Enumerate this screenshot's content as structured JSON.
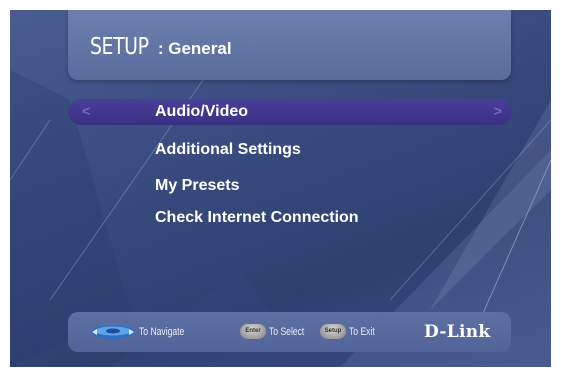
{
  "header": {
    "title_main": "SETUP",
    "title_sub": ": General"
  },
  "menu": {
    "selected_index": 0,
    "items": [
      {
        "label": "Audio/Video"
      },
      {
        "label": "Additional Settings"
      },
      {
        "label": "My Presets"
      },
      {
        "label": "Check Internet Connection"
      }
    ],
    "left_arrow": "<",
    "right_arrow": ">"
  },
  "footer": {
    "navigate": "To Navigate",
    "select_btn": "Enter",
    "select": "To Select",
    "exit_btn": "Setup",
    "exit": "To Exit",
    "logo": "D-Link"
  },
  "colors": {
    "background": "#3a4c80",
    "panel": "#5e70a2",
    "selection": "#3f3490",
    "text": "#ffffff"
  }
}
